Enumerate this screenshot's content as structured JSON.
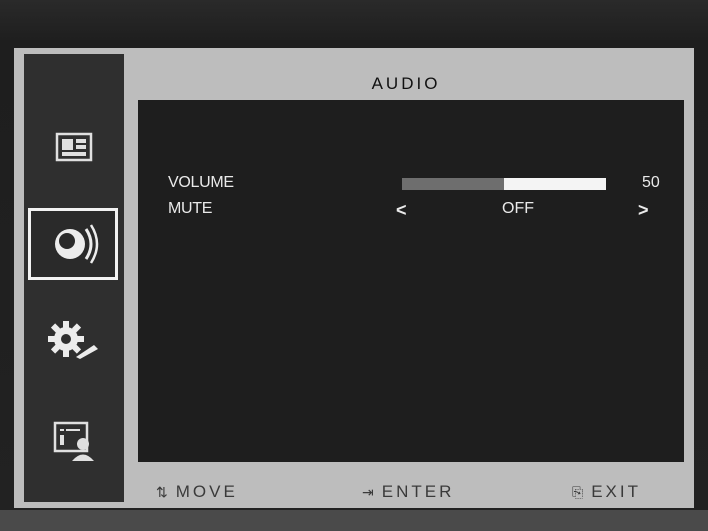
{
  "osd": {
    "title": "AUDIO",
    "menu_items": [
      {
        "icon": "picture-icon",
        "selected": false
      },
      {
        "icon": "audio-icon",
        "selected": true
      },
      {
        "icon": "setup-gear-icon",
        "selected": false
      },
      {
        "icon": "presentation-user-icon",
        "selected": false
      }
    ],
    "settings": {
      "volume": {
        "label": "VOLUME",
        "value": "50",
        "level": 0.5
      },
      "mute": {
        "label": "MUTE",
        "value": "OFF",
        "left_arrow": "<",
        "right_arrow": ">"
      }
    },
    "footer": {
      "move": {
        "icon": "up-down-arrows-icon",
        "glyph": "⇅",
        "label": "MOVE"
      },
      "enter": {
        "icon": "enter-icon",
        "glyph": "⇥",
        "label": "ENTER"
      },
      "exit": {
        "icon": "exit-icon",
        "glyph": "⎘",
        "label": "EXIT"
      }
    },
    "colors": {
      "highlight": "#f2f2f2",
      "panel": "#1e1e1e",
      "frame": "#bdbdbd"
    }
  }
}
